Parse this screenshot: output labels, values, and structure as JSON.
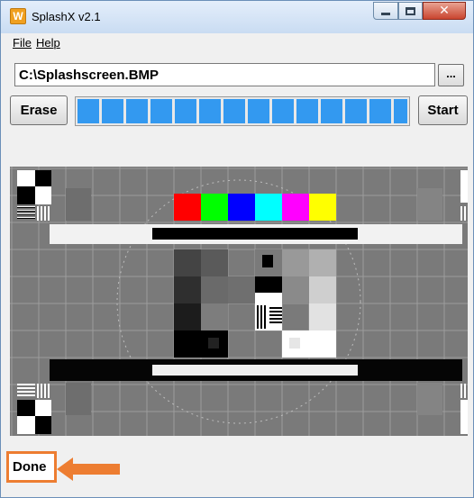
{
  "window": {
    "title": "SplashX v2.1",
    "app_icon_letter": "W",
    "close_glyph": "✕"
  },
  "menu": {
    "file": "File",
    "help": "Help"
  },
  "path": {
    "value": "C:\\Splashscreen.BMP",
    "browse_label": "..."
  },
  "actions": {
    "erase_label": "Erase",
    "start_label": "Start",
    "progress_fraction": 1.0,
    "progress_color": "#3399f0"
  },
  "colors": {
    "color_bars": [
      "#ff0000",
      "#00ff00",
      "#0000ff",
      "#00ffff",
      "#ff00ff",
      "#ffff00"
    ],
    "highlight": "#ed7d31"
  },
  "status": {
    "text": "Done"
  }
}
